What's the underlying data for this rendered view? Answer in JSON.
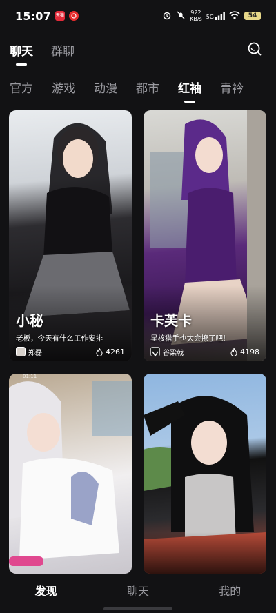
{
  "status_bar": {
    "time": "15:07",
    "net_speed_value": "922",
    "net_speed_unit": "KB/s",
    "network": "5G",
    "battery": "54",
    "notif_app_label": "天猫"
  },
  "top_tabs": [
    {
      "label": "聊天",
      "active": true
    },
    {
      "label": "群聊",
      "active": false
    }
  ],
  "search": {
    "icon": "search-icon"
  },
  "categories": [
    {
      "label": "官方",
      "active": false
    },
    {
      "label": "游戏",
      "active": false
    },
    {
      "label": "动漫",
      "active": false
    },
    {
      "label": "都市",
      "active": false
    },
    {
      "label": "红袖",
      "active": true
    },
    {
      "label": "青衿",
      "active": false
    }
  ],
  "cards": [
    {
      "title": "小秘",
      "desc": "老板，今天有什么工作安排",
      "author": "郑磊",
      "likes": "4261"
    },
    {
      "title": "卡芙卡",
      "desc": "星核猎手也太会撩了吧!",
      "author": "谷梁戟",
      "likes": "4198"
    },
    {
      "top_status": "01:11"
    },
    {}
  ],
  "bottom_nav": [
    {
      "label": "发现",
      "active": true
    },
    {
      "label": "聊天",
      "active": false
    },
    {
      "label": "我的",
      "active": false
    }
  ],
  "colors": {
    "background": "#121214",
    "active_text": "#ffffff",
    "inactive_text": "#9a9aa0",
    "battery": "#e7d88a"
  }
}
